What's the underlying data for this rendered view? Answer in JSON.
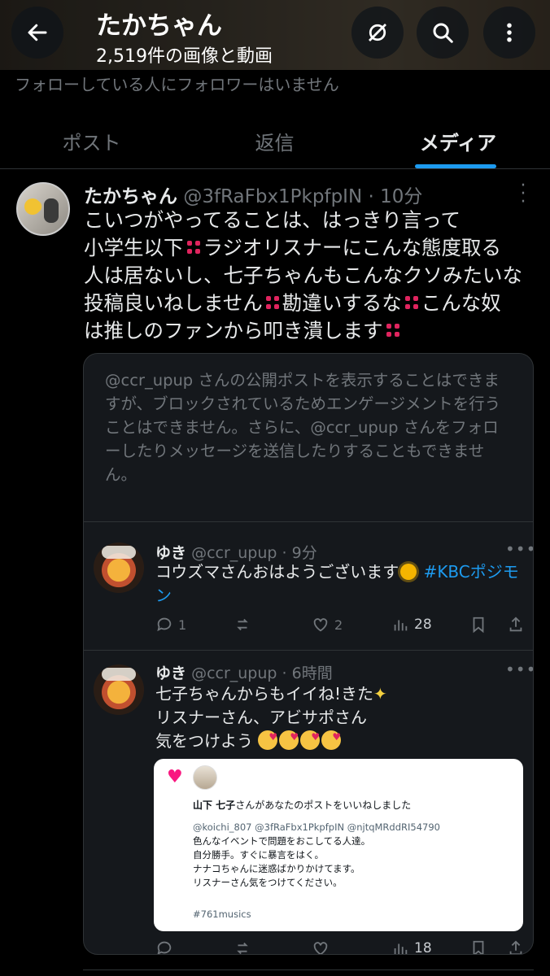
{
  "header": {
    "title": "たかちゃん",
    "subtitle": "2,519件の画像と動画",
    "icons": {
      "back": "arrow-left-icon",
      "hide": "eye-slash-icon",
      "search": "search-icon",
      "more": "more-vertical-icon"
    }
  },
  "follow_note": "フォローしている人にフォロワーはいません",
  "tabs": [
    {
      "label": "ポスト"
    },
    {
      "label": "返信"
    },
    {
      "label": "メディア",
      "active": true
    }
  ],
  "post": {
    "name": "たかちゃん",
    "handle": "@3fRaFbx1PkpfpIN",
    "time": "· 10分",
    "line1": "こいつがやってることは、はっきり言って",
    "line2a": "小学生以下",
    "line2b": "ラジオリスナーにこんな態度取る",
    "line3": "人は居ないし、七子ちゃんもこんなクソみたいな",
    "line4a": "投稿良いねしません",
    "line4b": "勘違いするな",
    "line4c": "こんな奴",
    "line5": "は推しのファンから叩き潰します"
  },
  "quote": {
    "blocked_text": "@ccr_upup さんの公開ポストを表示することはできますが、ブロックされているためエンゲージメントを行うことはできません。さらに、@ccr_upup さんをフォローしたりメッセージを送信したりすることもできません。",
    "reply1": {
      "name": "ゆき",
      "handle": "@ccr_upup",
      "time": "· 9分",
      "text_a": "コウズマさんおはようございます",
      "hashtag": "#KBCポジモン",
      "replies": "1",
      "likes": "2",
      "views": "28"
    },
    "reply2": {
      "name": "ゆき",
      "handle": "@ccr_upup",
      "time": "· 6時間",
      "line1": "七子ちゃんからもイイね!きた",
      "line2": "リスナーさん、アビサポさん",
      "line3": "気をつけよう",
      "views": "18"
    },
    "notification": {
      "title_bold": "山下 七子",
      "title_rest": "さんがあなたのポストをいいねしました",
      "mentions": "@koichi_807  @3fRaFbx1PkpfpIN @njtqMRddRI54790",
      "lines": [
        "色んなイベントで問題をおこしてる人達。",
        "自分勝手。すぐに暴言をはく。",
        "ナナコちゃんに迷惑ばかりかけてます。",
        "リスナーさん気をつけてください。"
      ],
      "tag": "#761musics"
    }
  },
  "colors": {
    "accent": "#1d9bf0",
    "background": "#000000",
    "muted": "#71767b",
    "like": "#f91880"
  }
}
